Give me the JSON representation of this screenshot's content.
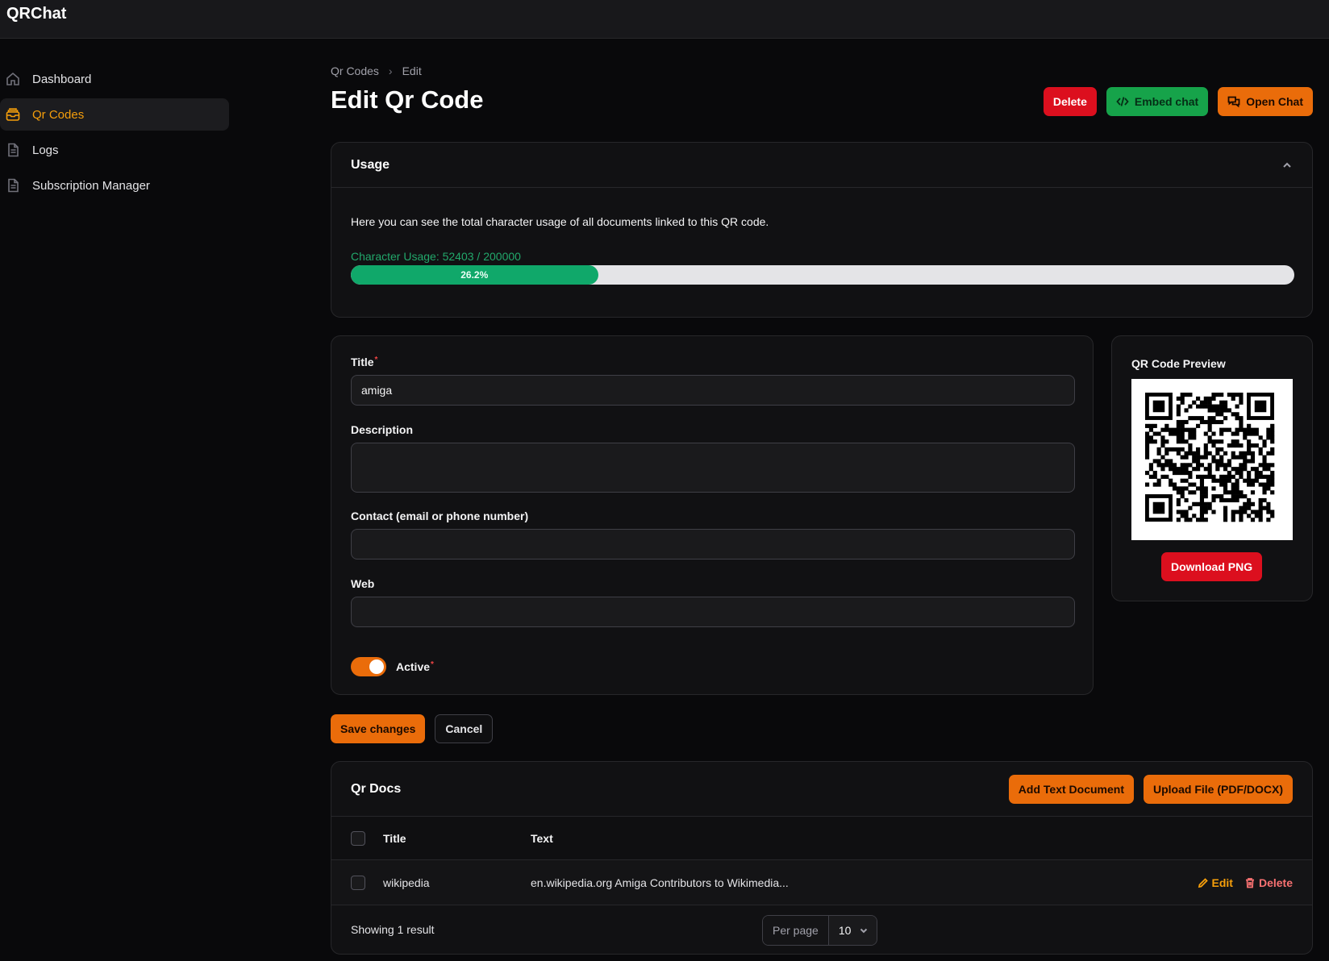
{
  "app": {
    "brand": "QRChat"
  },
  "sidebar": {
    "items": [
      {
        "label": "Dashboard",
        "icon": "home-icon"
      },
      {
        "label": "Qr Codes",
        "icon": "inbox-icon",
        "active": true
      },
      {
        "label": "Logs",
        "icon": "document-icon"
      },
      {
        "label": "Subscription Manager",
        "icon": "document-icon"
      }
    ]
  },
  "breadcrumb": {
    "root": "Qr Codes",
    "current": "Edit"
  },
  "header": {
    "title": "Edit Qr Code",
    "delete_label": "Delete",
    "embed_label": "Embed chat",
    "open_label": "Open Chat"
  },
  "usage": {
    "heading": "Usage",
    "description": "Here you can see the total character usage of all documents linked to this QR code.",
    "label": "Character Usage: 52403 / 200000",
    "used": 52403,
    "limit": 200000,
    "percent_text": "26.2%",
    "percent": 26.2
  },
  "form": {
    "title_label": "Title",
    "title_value": "amiga",
    "description_label": "Description",
    "description_value": "",
    "contact_label": "Contact (email or phone number)",
    "contact_value": "",
    "web_label": "Web",
    "web_value": "",
    "active_label": "Active",
    "active": true,
    "required_mark": "*"
  },
  "qr": {
    "title": "QR Code Preview",
    "download_label": "Download PNG"
  },
  "form_actions": {
    "save_label": "Save changes",
    "cancel_label": "Cancel"
  },
  "docs": {
    "heading": "Qr Docs",
    "add_text_label": "Add Text Document",
    "upload_label": "Upload File (PDF/DOCX)",
    "columns": [
      "Title",
      "Text"
    ],
    "rows": [
      {
        "title": "wikipedia",
        "text": "en.wikipedia.org Amiga Contributors to Wikimedia..."
      }
    ],
    "edit_label": "Edit",
    "delete_label": "Delete",
    "count_text": "Showing 1 result",
    "per_page_label": "Per page",
    "per_page_value": "10"
  },
  "colors": {
    "accent": "#f59e0b",
    "danger": "#dc0f1e",
    "success": "#16a34a",
    "primary_button": "#ea6c0a",
    "progress": "#10a86a"
  }
}
